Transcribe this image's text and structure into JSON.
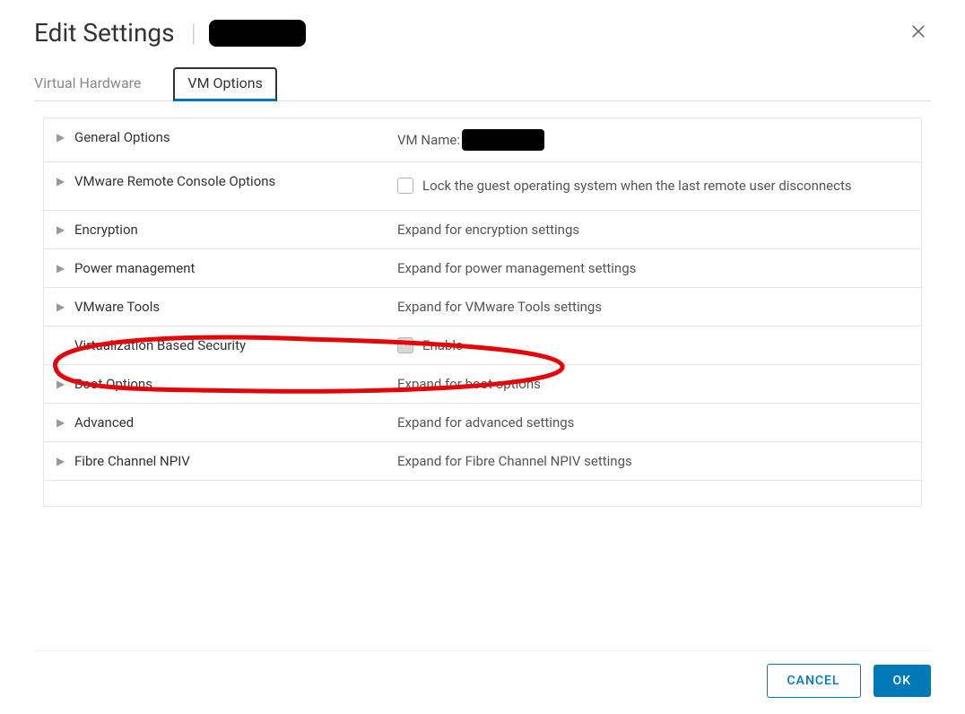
{
  "dialog": {
    "title": "Edit Settings"
  },
  "tabs": {
    "virtual_hardware": "Virtual Hardware",
    "vm_options": "VM Options"
  },
  "rows": {
    "general_options": {
      "label": "General Options",
      "value_prefix": "VM Name:"
    },
    "remote_console": {
      "label": "VMware Remote Console Options",
      "checkbox_label": "Lock the guest operating system when the last remote user disconnects"
    },
    "encryption": {
      "label": "Encryption",
      "value": "Expand for encryption settings"
    },
    "power_mgmt": {
      "label": "Power management",
      "value": "Expand for power management settings"
    },
    "vmware_tools": {
      "label": "VMware Tools",
      "value": "Expand for VMware Tools settings"
    },
    "vbs": {
      "label": "Virtualization Based Security",
      "checkbox_label": "Enable"
    },
    "boot_options": {
      "label": "Boot Options",
      "value": "Expand for boot options"
    },
    "advanced": {
      "label": "Advanced",
      "value": "Expand for advanced settings"
    },
    "fc_npiv": {
      "label": "Fibre Channel NPIV",
      "value": "Expand for Fibre Channel NPIV settings"
    }
  },
  "buttons": {
    "cancel": "CANCEL",
    "ok": "OK"
  }
}
